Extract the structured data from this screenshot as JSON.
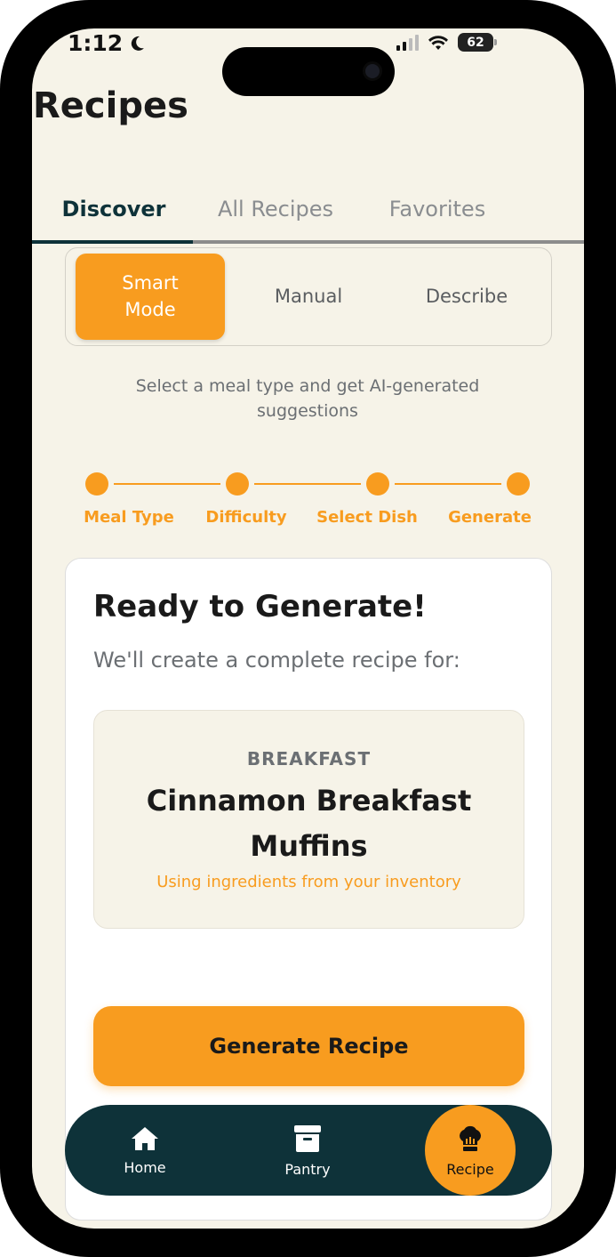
{
  "status_bar": {
    "time": "1:12",
    "battery": "62"
  },
  "page": {
    "title": "Recipes"
  },
  "tabs": [
    {
      "label": "Discover",
      "active": true
    },
    {
      "label": "All Recipes",
      "active": false
    },
    {
      "label": "Favorites",
      "active": false
    }
  ],
  "modes": [
    {
      "label": "Smart Mode",
      "active": true
    },
    {
      "label": "Manual",
      "active": false
    },
    {
      "label": "Describe",
      "active": false
    }
  ],
  "description": "Select a meal type and get AI-generated suggestions",
  "steps": [
    "Meal Type",
    "Difficulty",
    "Select Dish",
    "Generate"
  ],
  "card": {
    "title": "Ready to Generate!",
    "subtitle": "We'll create a complete recipe for:",
    "category": "BREAKFAST",
    "dish": "Cinnamon Breakfast Muffins",
    "note": "Using ingredients from your inventory",
    "button": "Generate Recipe"
  },
  "nav": [
    {
      "label": "Home",
      "icon": "home-icon"
    },
    {
      "label": "Pantry",
      "icon": "archive-icon"
    },
    {
      "label": "Recipe",
      "icon": "chef-hat-icon",
      "active": true
    }
  ],
  "colors": {
    "accent": "#f89c1f",
    "dark": "#0e3239",
    "background": "#f6f3e8"
  }
}
